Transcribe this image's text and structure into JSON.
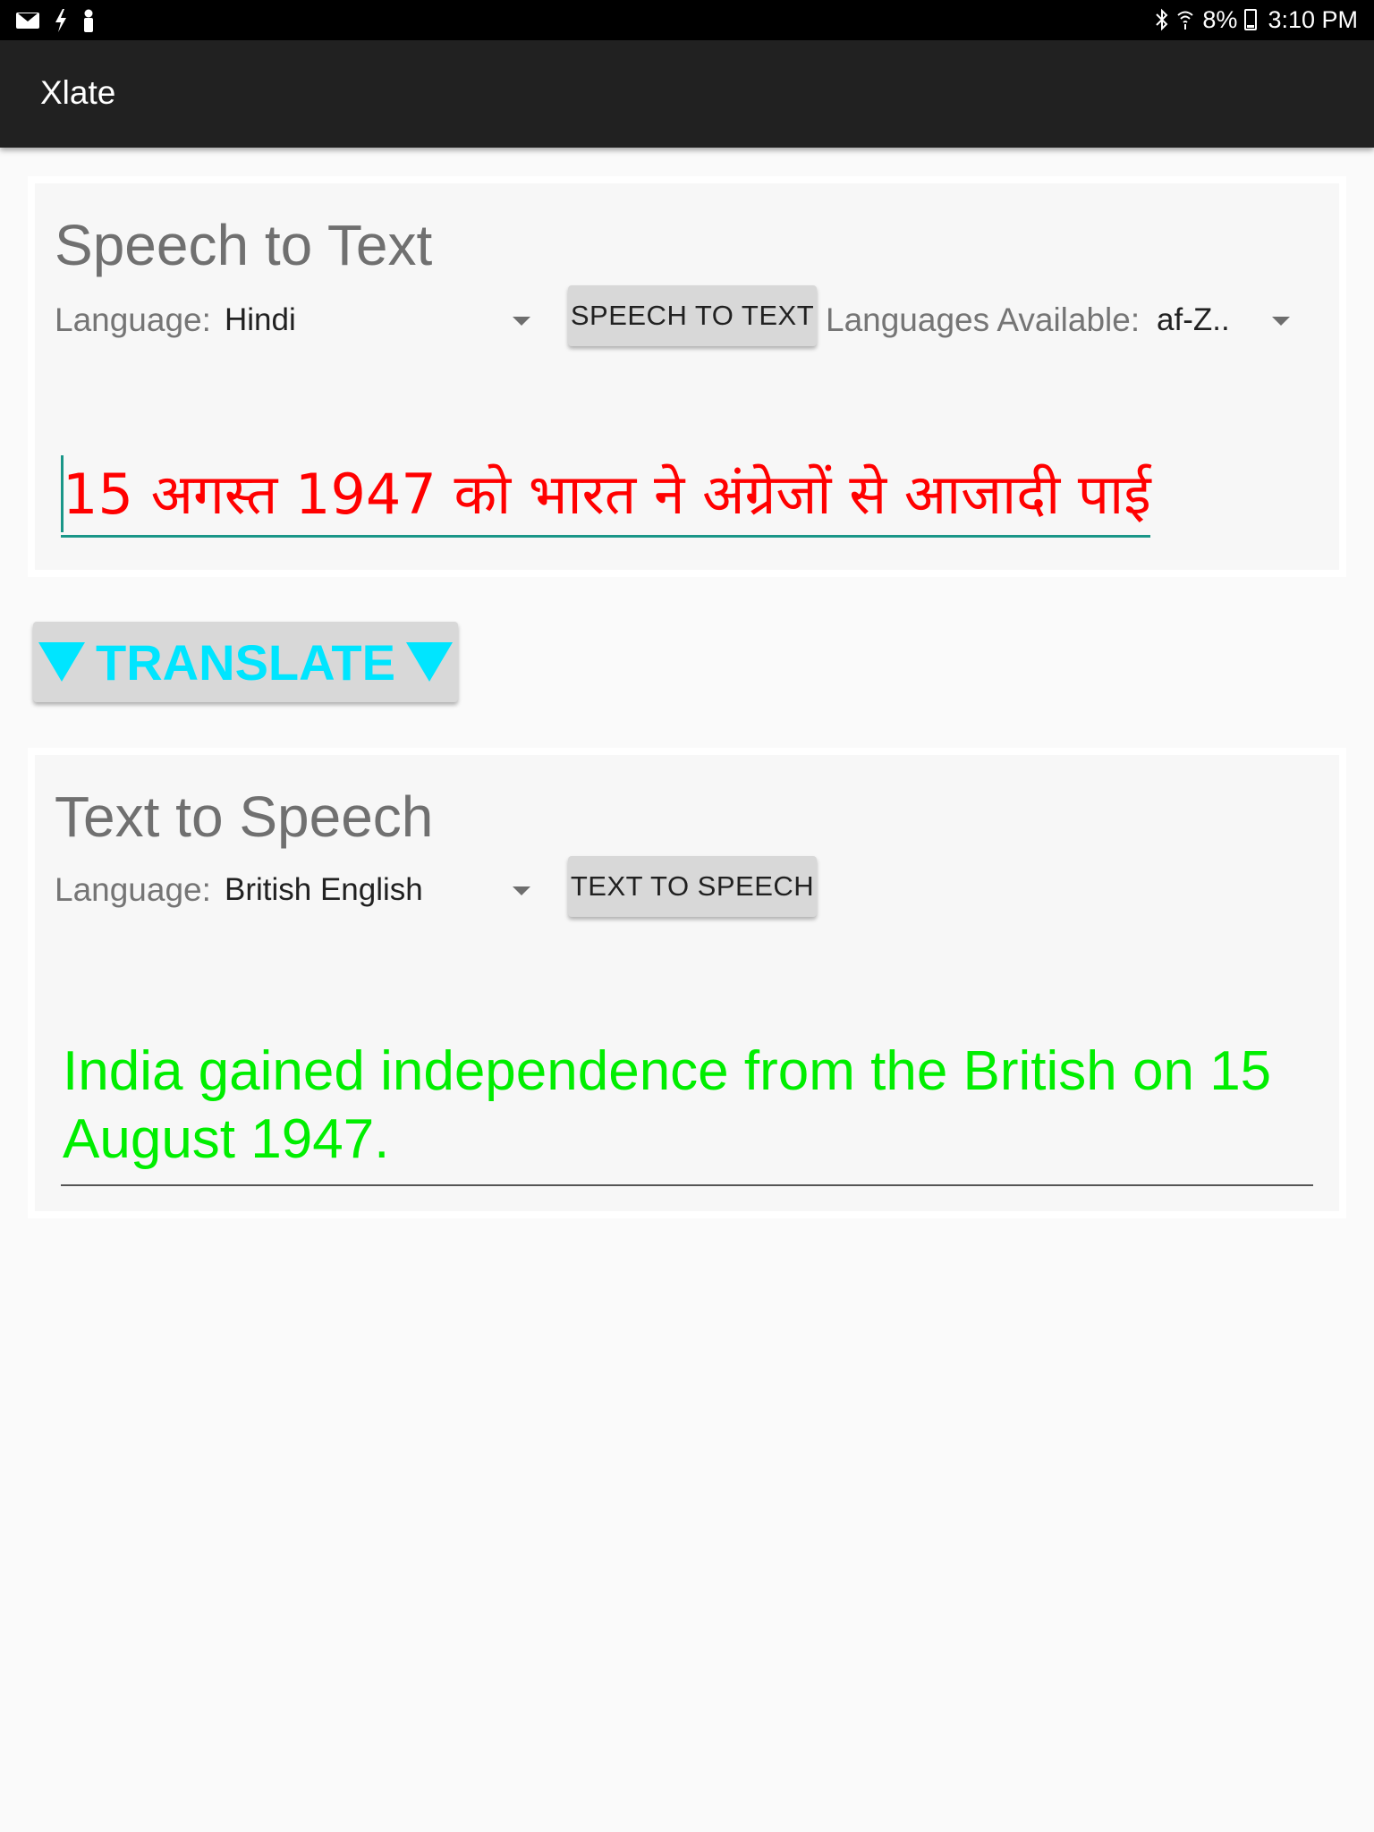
{
  "status_bar": {
    "battery": "8%",
    "time": "3:10 PM",
    "left_icons": [
      "mail-icon",
      "lightning-icon",
      "person-icon"
    ],
    "right_icons": [
      "bluetooth-icon",
      "wifi-icon",
      "battery-icon"
    ]
  },
  "app_bar": {
    "title": "Xlate"
  },
  "speech_to_text": {
    "title": "Speech to Text",
    "language_label": "Language:",
    "language_value": "Hindi",
    "button_label": "SPEECH TO TEXT",
    "available_label": "Languages Available:",
    "available_value": "af-Z..",
    "result_text": "15 अगस्त 1947 को भारत ने अंग्रेजों से आजादी पाई"
  },
  "translate": {
    "label": "TRANSLATE"
  },
  "text_to_speech": {
    "title": "Text to Speech",
    "language_label": "Language:",
    "language_value": "British English",
    "button_label": "TEXT TO SPEECH",
    "result_text": "India gained independence from the British on 15 August 1947."
  },
  "colors": {
    "hindi_text": "#ff0000",
    "english_text": "#00ee00",
    "translate_accent": "#00e5ff",
    "field_underline_active": "#1a9688",
    "app_bar": "#212121"
  }
}
